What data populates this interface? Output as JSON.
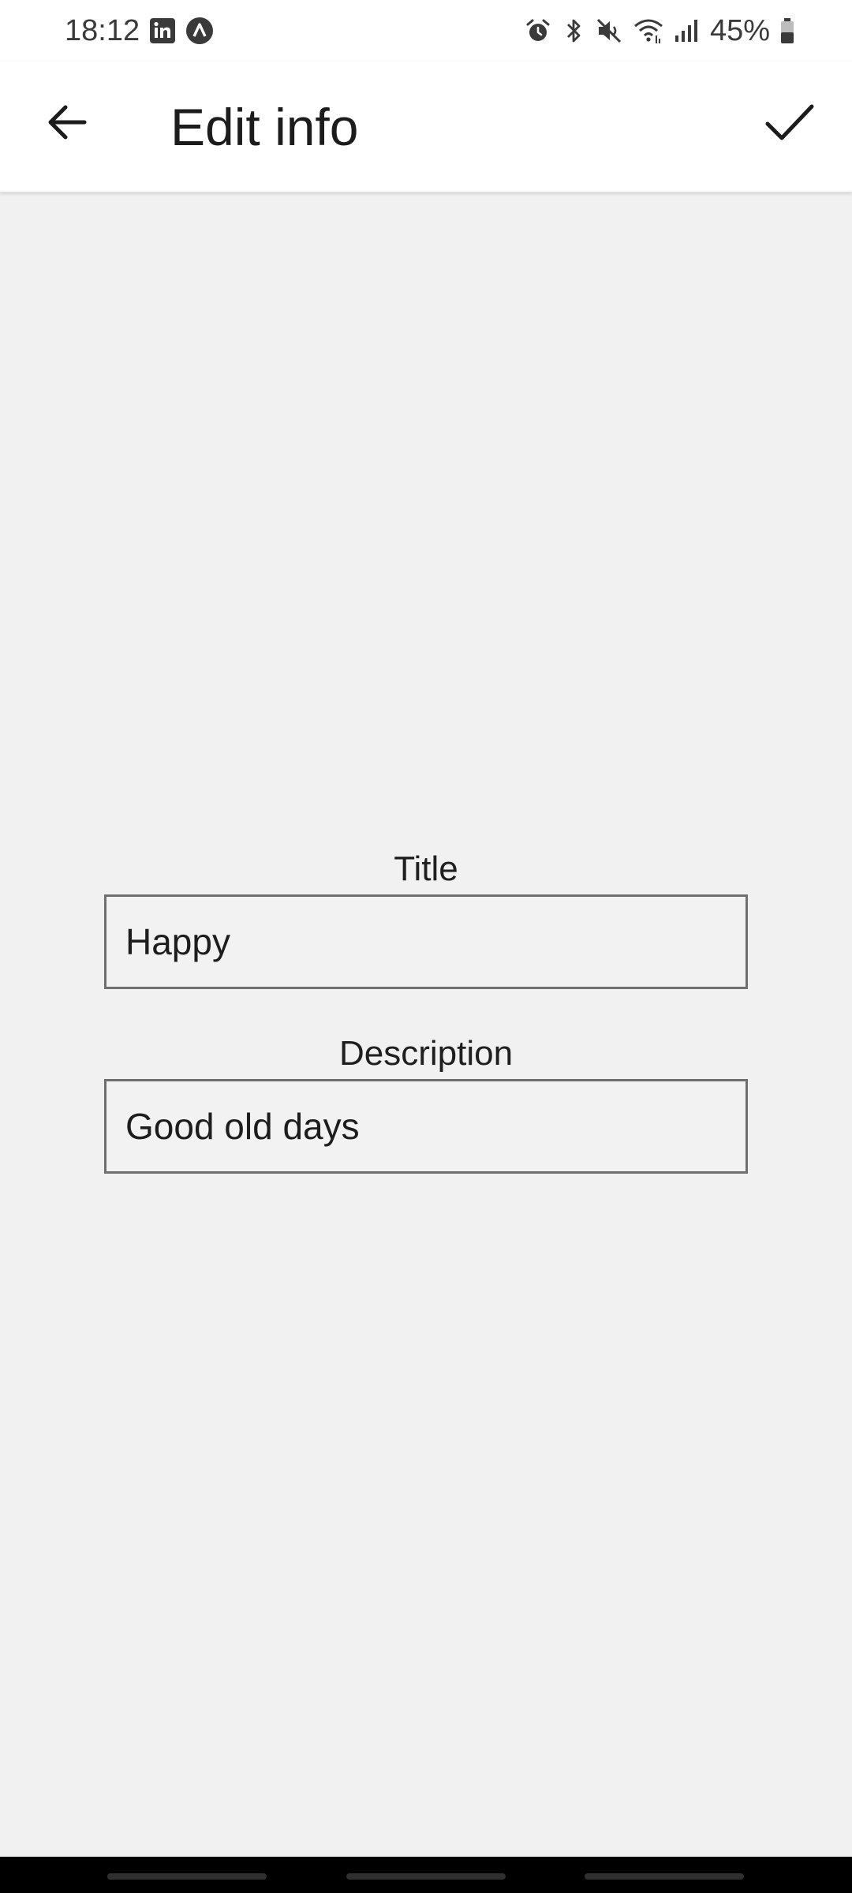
{
  "status_bar": {
    "time": "18:12",
    "battery": "45%",
    "left_icons": [
      "linkedin-icon",
      "app-caret-icon"
    ],
    "right_icons": [
      "alarm-icon",
      "bluetooth-icon",
      "mute-icon",
      "wifi-icon",
      "signal-icon",
      "battery-icon"
    ]
  },
  "app_bar": {
    "title": "Edit info",
    "back_icon": "arrow-back-icon",
    "confirm_icon": "check-icon"
  },
  "form": {
    "title_label": "Title",
    "title_value": "Happy",
    "description_label": "Description",
    "description_value": "Good old days"
  },
  "colors": {
    "background": "#f1f1f1",
    "app_bar": "#ffffff",
    "input_border": "#6f6f6f",
    "nav_bar": "#000000"
  }
}
